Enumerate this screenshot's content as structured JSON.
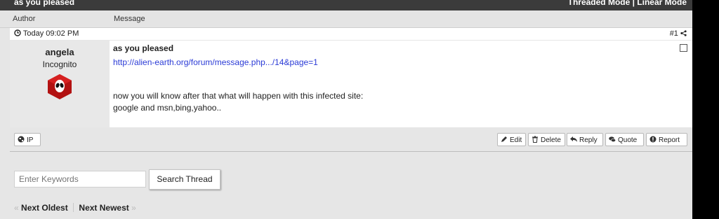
{
  "thread": {
    "title": "as you pleased",
    "modes": "Threaded Mode | Linear Mode"
  },
  "columns": {
    "author": "Author",
    "message": "Message"
  },
  "post": {
    "date": "Today 09:02 PM",
    "number": "#1",
    "author_name": "angela",
    "author_role": "Incognito",
    "subject": "as you pleased",
    "link": "http://alien-earth.org/forum/message.php.../14&page=1",
    "body_line1": "now you will know after that what will happen with this infected site:",
    "body_line2": "google and msn,bing,yahoo..",
    "ip_label": "IP",
    "actions": {
      "edit": "Edit",
      "delete": "Delete",
      "reply": "Reply",
      "quote": "Quote",
      "report": "Report"
    }
  },
  "search": {
    "placeholder": "Enter Keywords",
    "button": "Search Thread"
  },
  "nav": {
    "prev": "Next Oldest",
    "next": "Next Newest",
    "prev_arrow": "«",
    "next_arrow": "»"
  },
  "icons": [
    "clock-icon",
    "share-icon",
    "globe-icon",
    "pencil-icon",
    "trash-icon",
    "reply-icon",
    "quote-icon",
    "alert-icon",
    "avatar-alien-icon"
  ]
}
